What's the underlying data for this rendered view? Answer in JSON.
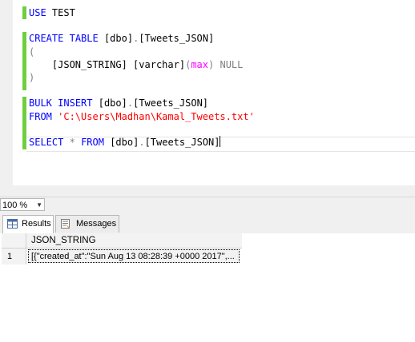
{
  "editor": {
    "lines": [
      {
        "parts": [
          {
            "t": "USE",
            "c": "kw"
          },
          {
            "t": " TEST",
            "c": ""
          }
        ]
      },
      {
        "parts": []
      },
      {
        "parts": [
          {
            "t": "CREATE",
            "c": "kw"
          },
          {
            "t": " ",
            "c": ""
          },
          {
            "t": "TABLE",
            "c": "kw"
          },
          {
            "t": " [dbo]",
            "c": ""
          },
          {
            "t": ".",
            "c": "gry"
          },
          {
            "t": "[Tweets_JSON]",
            "c": ""
          }
        ]
      },
      {
        "parts": [
          {
            "t": "(",
            "c": "gry"
          }
        ]
      },
      {
        "parts": [
          {
            "t": "    [JSON_STRING] ",
            "c": ""
          },
          {
            "t": "[varchar]",
            "c": ""
          },
          {
            "t": "(",
            "c": "gry"
          },
          {
            "t": "max",
            "c": "fn"
          },
          {
            "t": ")",
            "c": "gry"
          },
          {
            "t": " ",
            "c": ""
          },
          {
            "t": "NULL",
            "c": "gry"
          }
        ]
      },
      {
        "parts": [
          {
            "t": ")",
            "c": "gry"
          }
        ]
      },
      {
        "parts": []
      },
      {
        "parts": [
          {
            "t": "BULK",
            "c": "kw"
          },
          {
            "t": " ",
            "c": ""
          },
          {
            "t": "INSERT",
            "c": "kw"
          },
          {
            "t": " [dbo]",
            "c": ""
          },
          {
            "t": ".",
            "c": "gry"
          },
          {
            "t": "[Tweets_JSON]",
            "c": ""
          }
        ]
      },
      {
        "parts": [
          {
            "t": "FROM",
            "c": "kw"
          },
          {
            "t": " ",
            "c": ""
          },
          {
            "t": "'C:\\Users\\Madhan\\Kamal_Tweets.txt'",
            "c": "str"
          }
        ]
      },
      {
        "parts": []
      },
      {
        "parts": [
          {
            "t": "SELECT",
            "c": "kw"
          },
          {
            "t": " ",
            "c": ""
          },
          {
            "t": "*",
            "c": "gry"
          },
          {
            "t": " ",
            "c": ""
          },
          {
            "t": "FROM",
            "c": "kw"
          },
          {
            "t": " [dbo]",
            "c": ""
          },
          {
            "t": ".",
            "c": "gry"
          },
          {
            "t": "[Tweets_JSON]",
            "c": ""
          }
        ],
        "caret": true
      }
    ]
  },
  "zoom": {
    "value": "100 %"
  },
  "tabs": [
    {
      "label": "Results",
      "icon": "grid-icon",
      "active": true
    },
    {
      "label": "Messages",
      "icon": "messages-icon",
      "active": false
    }
  ],
  "grid": {
    "columns": [
      "JSON_STRING"
    ],
    "rows": [
      {
        "num": "1",
        "cells": [
          "[{\"created_at\":\"Sun Aug 13 08:28:39 +0000 2017\",..."
        ]
      }
    ]
  },
  "colors": {
    "keyword": "#0000ff",
    "string": "#ff0000",
    "operator": "#808080",
    "function": "#ff00ff",
    "change_bar": "#6fcf3f"
  }
}
